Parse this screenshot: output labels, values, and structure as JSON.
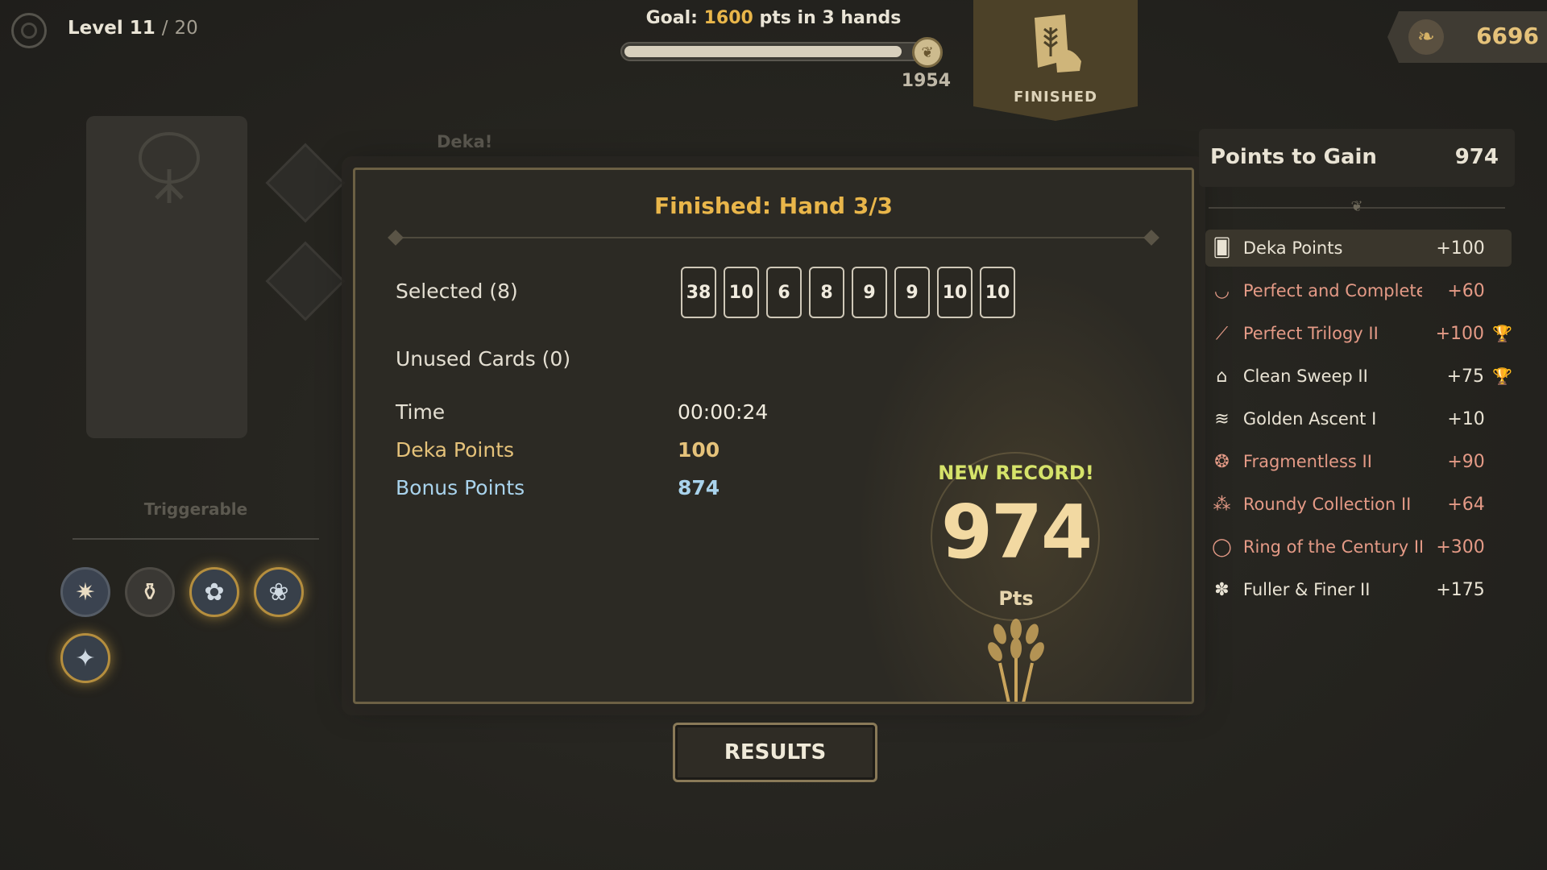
{
  "top_bar": {
    "level_label": "Level 11",
    "level_separator": "/",
    "level_max": "20",
    "goal_prefix": "Goal:",
    "goal_points": "1600",
    "goal_suffix": "pts in 3 hands",
    "progress_score": "1954",
    "progress_fraction": 0.93,
    "status_label": "FINISHED",
    "currency_value": "6696"
  },
  "background": {
    "deka_label": "Deka!",
    "triggerable_label": "Triggerable"
  },
  "modal": {
    "title": "Finished: Hand 3/3",
    "selected_label": "Selected (8)",
    "selected_cards": [
      "38",
      "10",
      "6",
      "8",
      "9",
      "9",
      "10",
      "10"
    ],
    "unused_label": "Unused Cards (0)",
    "time_label": "Time",
    "time_value": "00:00:24",
    "deka_points_label": "Deka Points",
    "deka_points_value": "100",
    "bonus_points_label": "Bonus Points",
    "bonus_points_value": "874",
    "new_record_label": "NEW RECORD!",
    "total_score": "974",
    "total_unit": "Pts"
  },
  "results_button_label": "RESULTS",
  "points_panel": {
    "title": "Points to Gain",
    "total": "974",
    "items": [
      {
        "name": "Deka Points",
        "value": "+100",
        "trophy": false,
        "icon": "cards-icon",
        "color": "#e9e3d4"
      },
      {
        "name": "Perfect and Complete ...",
        "value": "+60",
        "trophy": false,
        "icon": "necklace-icon",
        "color": "#e49a86"
      },
      {
        "name": "Perfect Trilogy II",
        "value": "+100",
        "trophy": true,
        "icon": "fan-icon",
        "color": "#e49a86"
      },
      {
        "name": "Clean Sweep II",
        "value": "+75",
        "trophy": true,
        "icon": "broom-icon",
        "color": "#e9e3d4"
      },
      {
        "name": "Golden Ascent I",
        "value": "+10",
        "trophy": false,
        "icon": "coin-stack-icon",
        "color": "#e9e3d4"
      },
      {
        "name": "Fragmentless II",
        "value": "+90",
        "trophy": false,
        "icon": "shell-icon",
        "color": "#e49a86"
      },
      {
        "name": "Roundy Collection II",
        "value": "+64",
        "trophy": false,
        "icon": "beads-icon",
        "color": "#e49a86"
      },
      {
        "name": "Ring of the Century II",
        "value": "+300",
        "trophy": false,
        "icon": "ring-icon",
        "color": "#e49a86"
      },
      {
        "name": "Fuller & Finer II",
        "value": "+175",
        "trophy": false,
        "icon": "flower-icon",
        "color": "#e9e3d4"
      }
    ]
  },
  "colors": {
    "gold": "#e9b64a",
    "deka": "#e5c27a",
    "bonus": "#a9d3ec",
    "record": "#d6e36a",
    "negative_accent": "#e49a86"
  }
}
